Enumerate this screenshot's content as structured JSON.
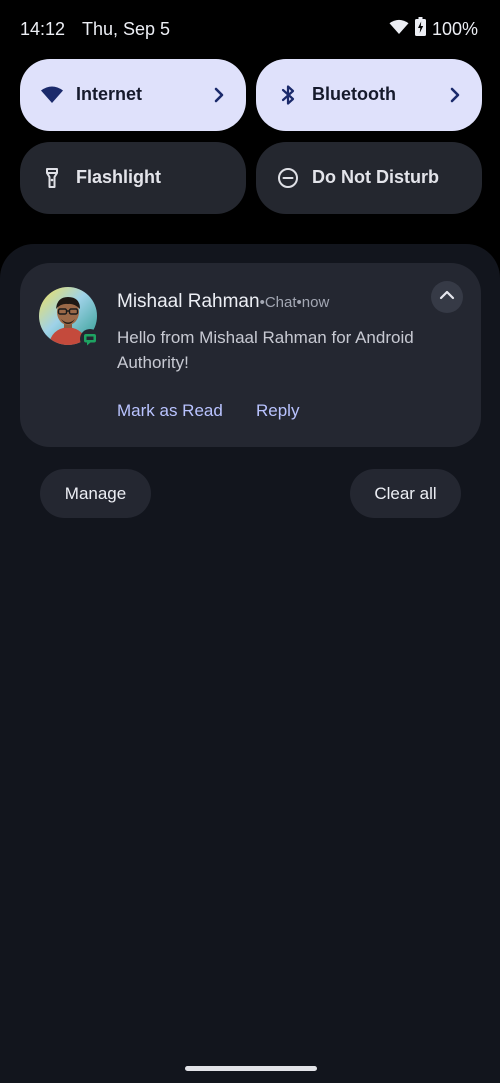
{
  "status_bar": {
    "time": "14:12",
    "date": "Thu, Sep 5",
    "battery_percent": "100%",
    "icons": [
      "wifi-icon",
      "battery-icon"
    ]
  },
  "quick_settings": [
    {
      "label": "Internet",
      "icon": "wifi-icon",
      "active": true,
      "has_detail": true
    },
    {
      "label": "Bluetooth",
      "icon": "bluetooth-icon",
      "active": true,
      "has_detail": true
    },
    {
      "label": "Flashlight",
      "icon": "flashlight-icon",
      "active": false,
      "has_detail": false
    },
    {
      "label": "Do Not Disturb",
      "icon": "do-not-disturb-icon",
      "active": false,
      "has_detail": false
    }
  ],
  "notification": {
    "sender": "Mishaal Rahman",
    "app": "Chat",
    "time": "now",
    "separator": " • ",
    "message": "Hello from Mishaal Rahman for Android Authority!",
    "actions": [
      "Mark as Read",
      "Reply"
    ],
    "app_badge_icon": "chat-app-icon",
    "expand_icon": "chevron-up-icon"
  },
  "footer": {
    "manage_label": "Manage",
    "clear_label": "Clear all"
  },
  "colors": {
    "tile_active": "#dfe1fb",
    "tile_inactive": "#24272f",
    "shade_bg": "#12151d",
    "card_bg": "#242731",
    "action_text": "#b9c3ff",
    "chat_green": "#1ea362"
  }
}
